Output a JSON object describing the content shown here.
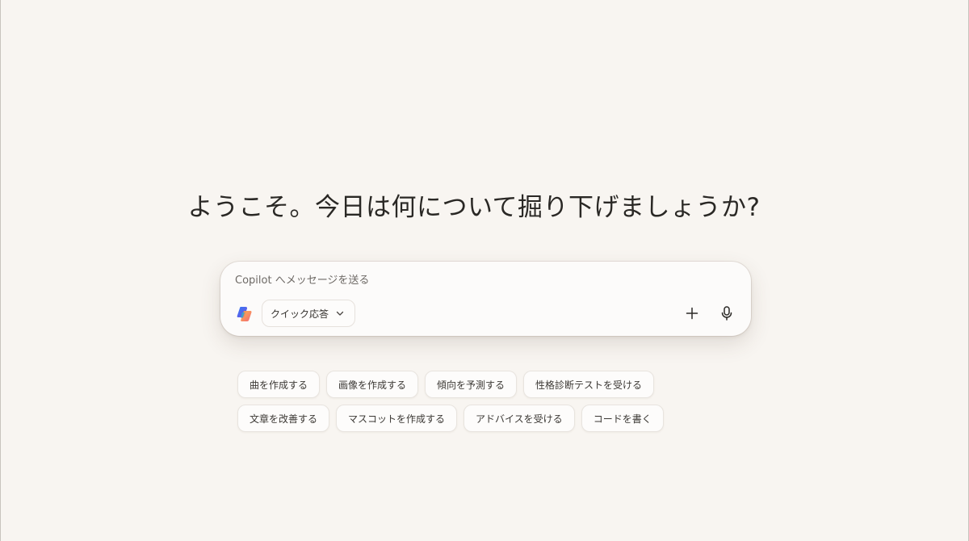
{
  "heading": "ようこそ。今日は何について掘り下げましょうか?",
  "composer": {
    "placeholder": "Copilot へメッセージを送る",
    "mode_label": "クイック応答",
    "logo_icon": "copilot-logo-icon",
    "plus_icon": "plus-icon",
    "mic_icon": "microphone-icon"
  },
  "suggestions": {
    "row1": [
      "曲を作成する",
      "画像を作成する",
      "傾向を予測する",
      "性格診断テストを受ける"
    ],
    "row2": [
      "文章を改善する",
      "マスコットを作成する",
      "アドバイスを受ける",
      "コードを書く"
    ]
  },
  "colors": {
    "background": "#f8f5f1",
    "composer_bg": "#fcfbfa",
    "chip_border": "#e8e4df",
    "text": "#2b2926"
  }
}
